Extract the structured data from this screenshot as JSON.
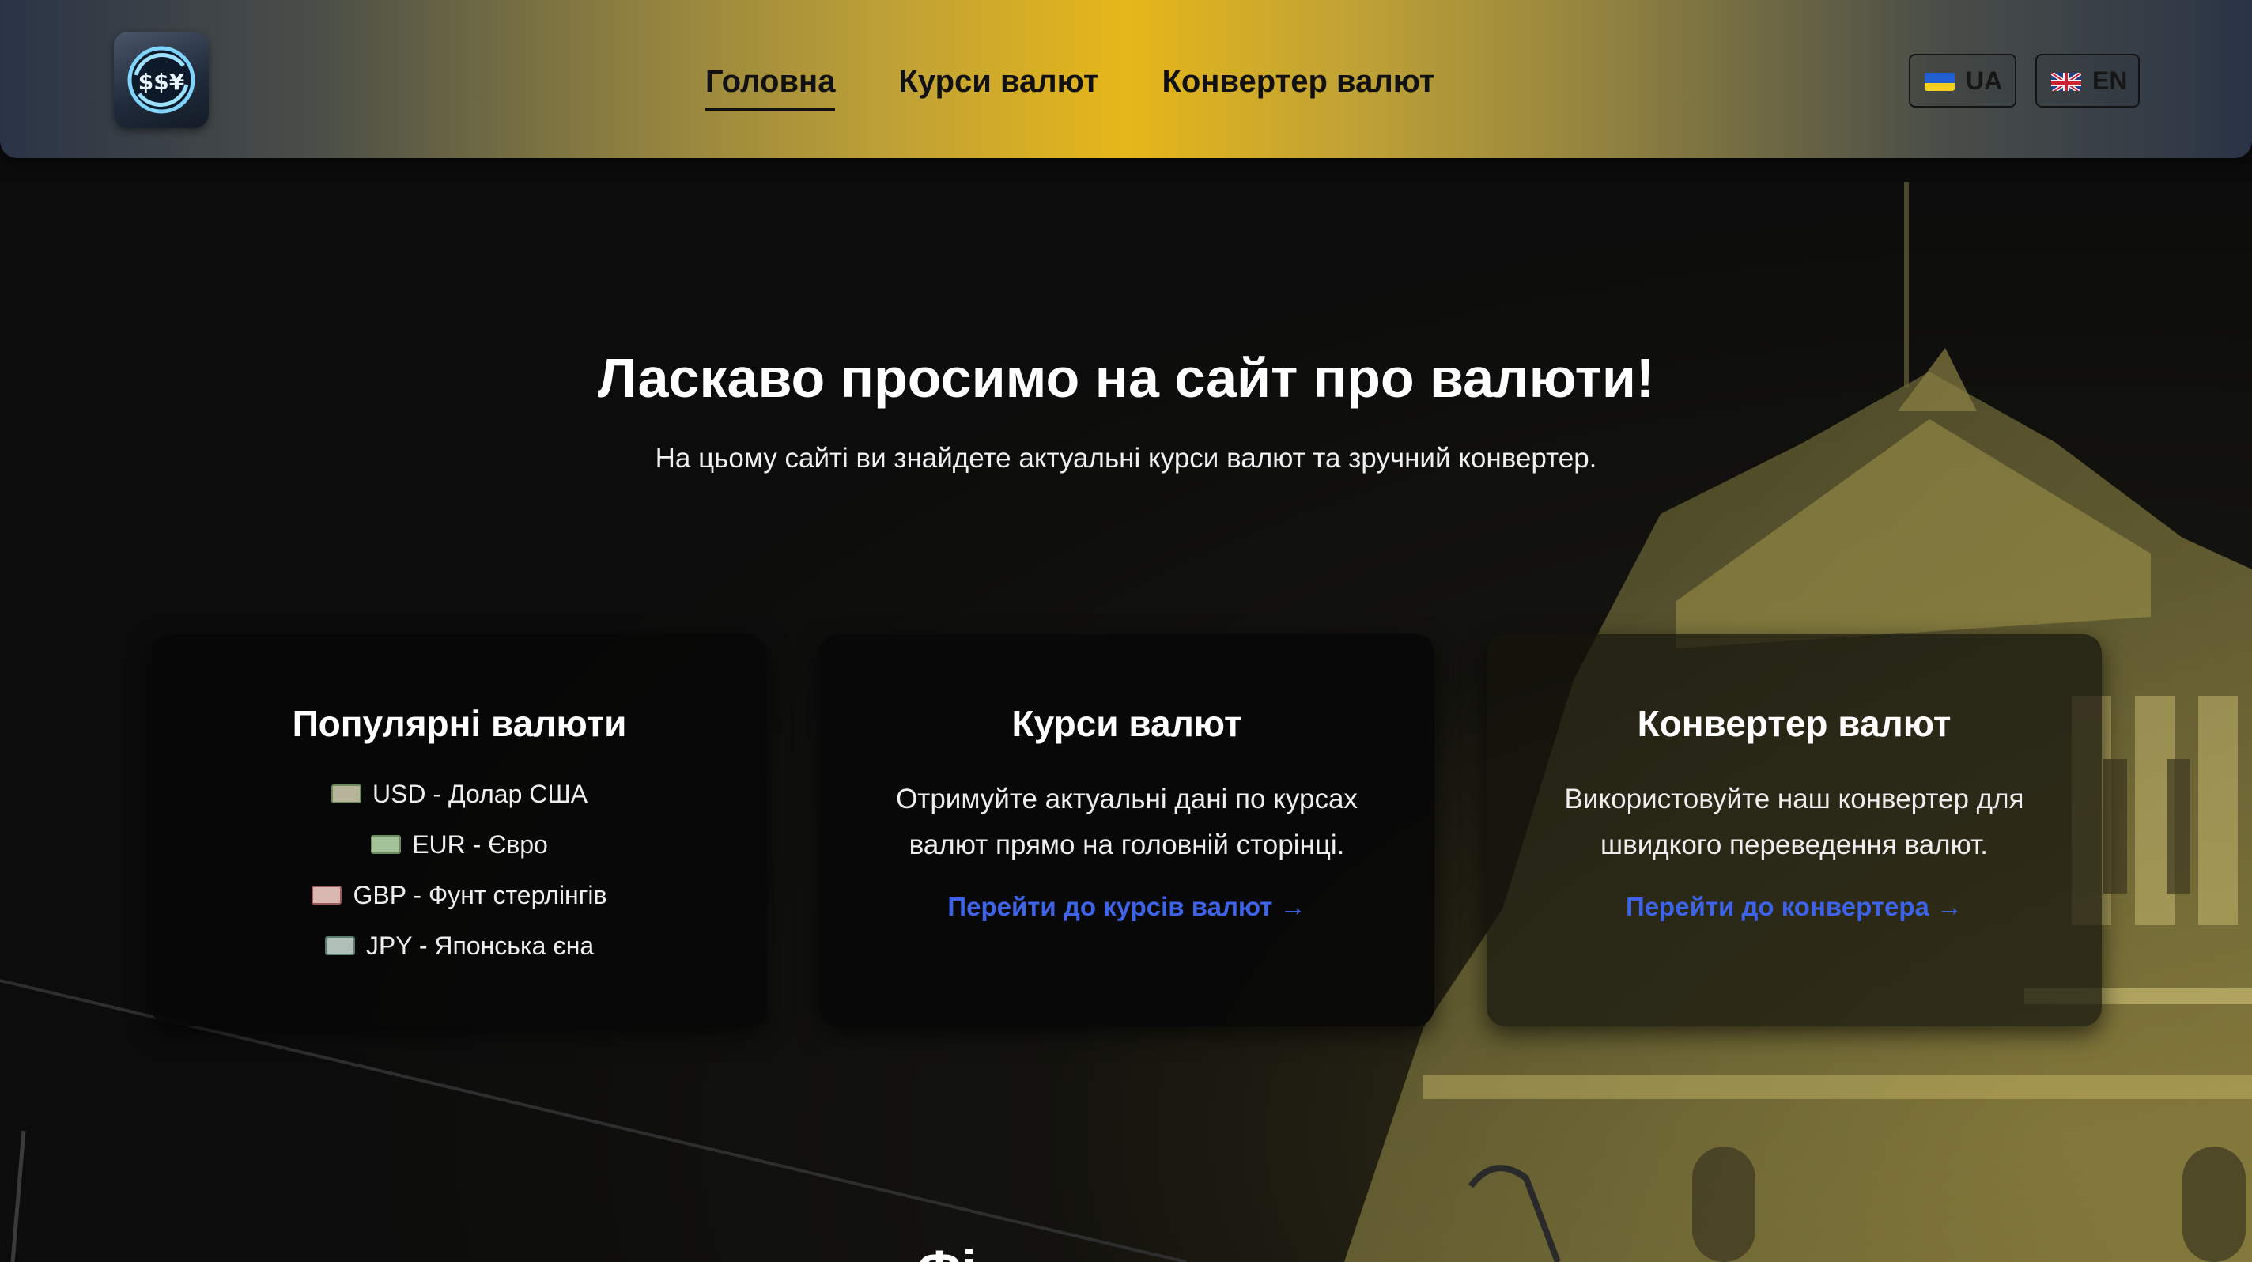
{
  "nav": {
    "items": [
      {
        "label": "Головна",
        "active": true
      },
      {
        "label": "Курси валют",
        "active": false
      },
      {
        "label": "Конвертер валют",
        "active": false
      }
    ]
  },
  "languages": {
    "ua": "UA",
    "en": "EN"
  },
  "hero": {
    "title": "Ласкаво просимо на сайт про валюти!",
    "subtitle": "На цьому сайті ви знайдете актуальні курси валют та зручний конвертер."
  },
  "cards": {
    "popular": {
      "title": "Популярні валюти",
      "items": [
        "USD - Долар США",
        "EUR - Євро",
        "GBP - Фунт стерлінгів",
        "JPY - Японська єна"
      ]
    },
    "rates": {
      "title": "Курси валют",
      "text": "Отримуйте актуальні дані по курсах валют прямо на головній сторінці.",
      "link": "Перейти до курсів валют →"
    },
    "converter": {
      "title": "Конвертер валют",
      "text": "Використовуйте наш конвертер для швидкого переведення валют.",
      "link": "Перейти до конвертера →"
    }
  },
  "next_section_partial": "Фі...",
  "colors": {
    "accent_link": "#3d63e8",
    "header_center": "#e6b719",
    "page_bg": "#0c0c0c"
  }
}
